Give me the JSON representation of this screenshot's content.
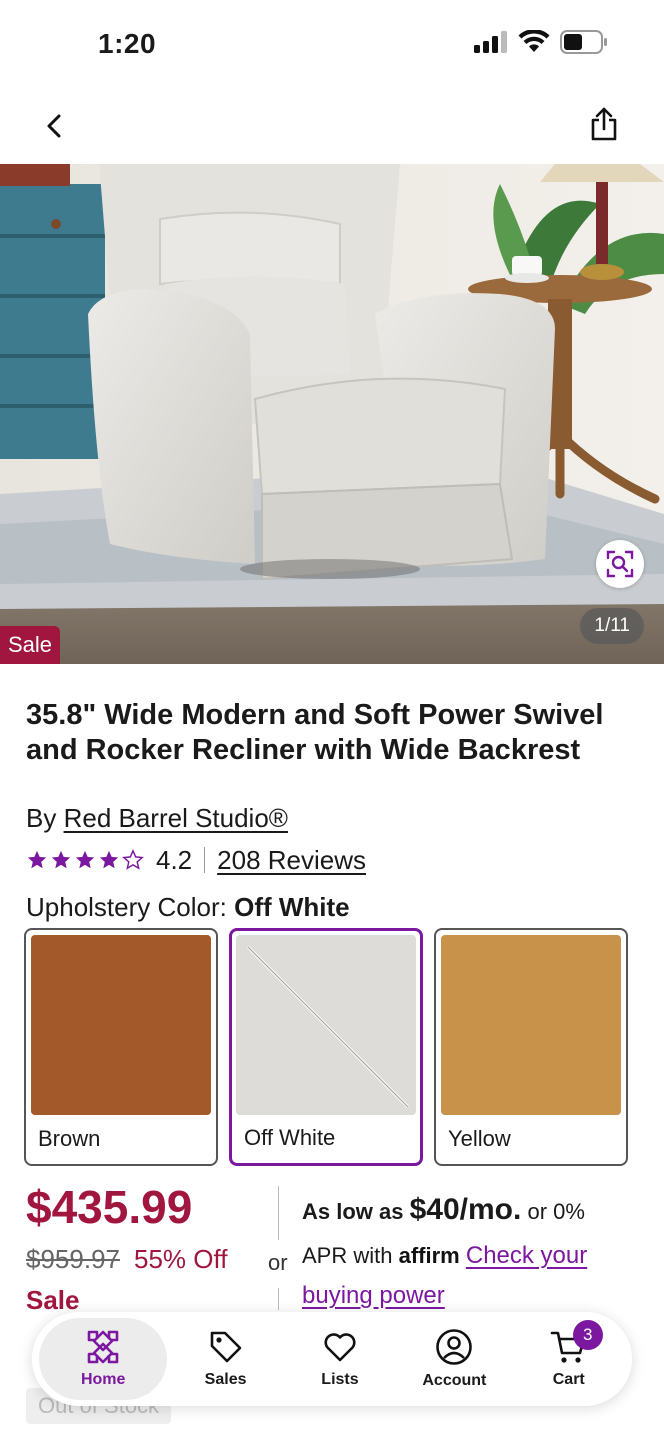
{
  "status_bar": {
    "time": "1:20"
  },
  "hero": {
    "sale_badge": "Sale",
    "counter": "1/11"
  },
  "product": {
    "title": "35.8\" Wide Modern and Soft Power Swivel and Rocker Recliner with Wide Backrest",
    "brand_prefix": "By",
    "brand": "Red Barrel Studio®",
    "rating": "4.2",
    "rating_stars": 4.2,
    "reviews_label": "208 Reviews"
  },
  "color_selector": {
    "label": "Upholstery Color:",
    "selected": "Off White",
    "options": [
      {
        "name": "Brown",
        "color": "#a3592a"
      },
      {
        "name": "Off White",
        "color": "#dedcd8"
      },
      {
        "name": "Yellow",
        "color": "#c8924a"
      }
    ]
  },
  "pricing": {
    "price": "$435.99",
    "original_price": "$959.97",
    "discount": "55% Off",
    "sale_label": "Sale",
    "or": "or",
    "affirm_prefix": "As low as",
    "affirm_amount": "$40/mo.",
    "affirm_rate": "or 0%",
    "affirm_apr": "APR with",
    "affirm_brand": "affirm",
    "affirm_link_1": "Check your",
    "affirm_link_2": "buying power"
  },
  "stock_badge": "Out of Stock",
  "tab_bar": {
    "tabs": [
      {
        "label": "Home",
        "icon": "home-icon"
      },
      {
        "label": "Sales",
        "icon": "tag-icon"
      },
      {
        "label": "Lists",
        "icon": "heart-icon"
      },
      {
        "label": "Account",
        "icon": "account-icon"
      },
      {
        "label": "Cart",
        "icon": "cart-icon"
      }
    ],
    "cart_count": "3"
  },
  "colors": {
    "accent": "#7b189f",
    "sale": "#a0163f"
  }
}
